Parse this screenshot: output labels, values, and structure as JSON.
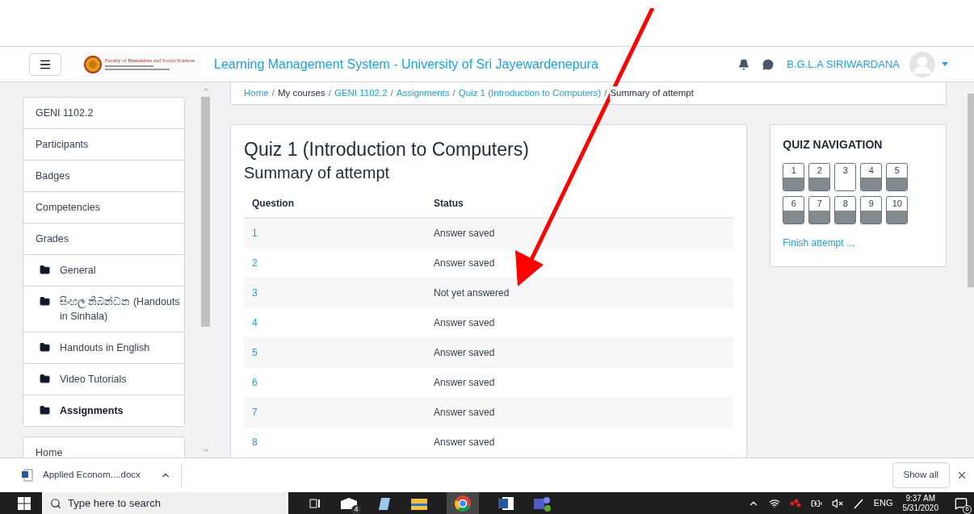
{
  "header": {
    "logo_text": "Faculty of Humanities and Social Sciences",
    "site_title": "Learning Management System - University of Sri Jayewardenepura",
    "user_name": "B.G.L.A SIRIWARDANA"
  },
  "sidebar": {
    "items": [
      {
        "label": "GENI 1102.2",
        "kind": "course",
        "selected": false
      },
      {
        "label": "Participants",
        "kind": "link",
        "selected": false
      },
      {
        "label": "Badges",
        "kind": "link",
        "selected": false
      },
      {
        "label": "Competencies",
        "kind": "link",
        "selected": false
      },
      {
        "label": "Grades",
        "kind": "link",
        "selected": false
      },
      {
        "label": "General",
        "kind": "folder",
        "selected": false
      },
      {
        "label": "සිංහල නිබන්ධන (Handouts in Sinhala)",
        "kind": "folder",
        "selected": false
      },
      {
        "label": "Handouts in English",
        "kind": "folder",
        "selected": false
      },
      {
        "label": "Video Tutorials",
        "kind": "folder",
        "selected": false
      },
      {
        "label": "Assignments",
        "kind": "folder",
        "selected": true
      }
    ],
    "footer_items": [
      {
        "label": "Home"
      }
    ]
  },
  "breadcrumb": [
    {
      "label": "Home",
      "link": true,
      "separator": "/"
    },
    {
      "label": "My courses",
      "link": false,
      "separator": "/"
    },
    {
      "label": "GENI 1102.2",
      "link": true,
      "separator": "/"
    },
    {
      "label": "Assignments",
      "link": true,
      "separator": "/"
    },
    {
      "label": "Quiz 1 (Introduction to Computers)",
      "link": true,
      "separator": "/"
    },
    {
      "label": "Summary of attempt",
      "link": false
    }
  ],
  "quiz": {
    "title": "Quiz 1 (Introduction to Computers)",
    "subtitle": "Summary of attempt",
    "columns": [
      "Question",
      "Status"
    ],
    "rows": [
      {
        "question": "1",
        "status": "Answer saved"
      },
      {
        "question": "2",
        "status": "Answer saved"
      },
      {
        "question": "3",
        "status": "Not yet answered"
      },
      {
        "question": "4",
        "status": "Answer saved"
      },
      {
        "question": "5",
        "status": "Answer saved"
      },
      {
        "question": "6",
        "status": "Answer saved"
      },
      {
        "question": "7",
        "status": "Answer saved"
      },
      {
        "question": "8",
        "status": "Answer saved"
      }
    ]
  },
  "quiz_navigation": {
    "title": "QUIZ NAVIGATION",
    "questions": [
      {
        "label": "1",
        "answered": true
      },
      {
        "label": "2",
        "answered": true
      },
      {
        "label": "3",
        "answered": false
      },
      {
        "label": "4",
        "answered": true
      },
      {
        "label": "5",
        "answered": true
      },
      {
        "label": "6",
        "answered": true
      },
      {
        "label": "7",
        "answered": true
      },
      {
        "label": "8",
        "answered": true
      },
      {
        "label": "9",
        "answered": true
      },
      {
        "label": "10",
        "answered": true
      }
    ],
    "finish_link": "Finish attempt ..."
  },
  "downloads_bar": {
    "file": "Applied Econom....docx",
    "show_all": "Show all"
  },
  "taskbar": {
    "search_placeholder": "Type here to search",
    "mail_badge": "4",
    "language": "ENG",
    "time": "9:37 AM",
    "date": "5/31/2020",
    "notification_count": "6"
  }
}
